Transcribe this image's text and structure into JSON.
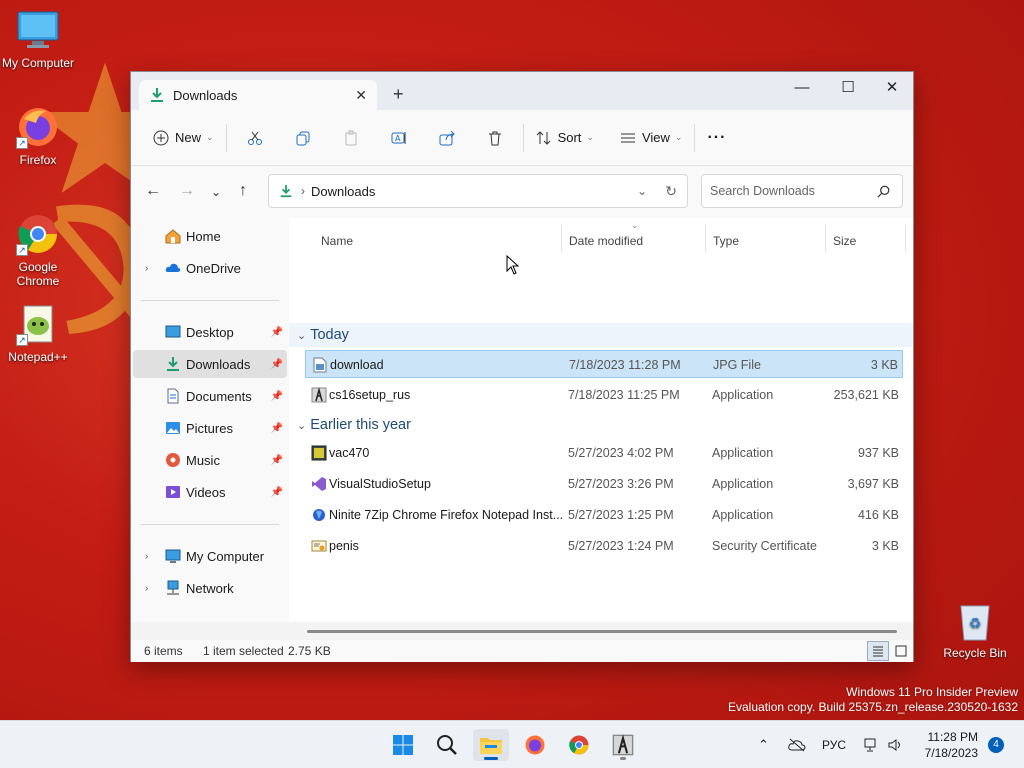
{
  "desktop": {
    "icons": [
      {
        "label": "My Computer",
        "icon": "monitor-icon"
      },
      {
        "label": "Firefox",
        "icon": "firefox-icon"
      },
      {
        "label": "Google Chrome",
        "icon": "chrome-icon"
      },
      {
        "label": "Notepad++",
        "icon": "notepadpp-icon"
      },
      {
        "label": "Recycle Bin",
        "icon": "recycle-bin-icon"
      }
    ],
    "watermark_line1": "Windows 11 Pro Insider Preview",
    "watermark_line2": "Evaluation copy. Build 25375.zn_release.230520-1632"
  },
  "window": {
    "tab_title": "Downloads",
    "toolbar": {
      "new_label": "New",
      "sort_label": "Sort",
      "view_label": "View",
      "more_label": "···"
    },
    "address": {
      "path": "Downloads",
      "search_placeholder": "Search Downloads"
    },
    "sidebar": {
      "items": [
        {
          "label": "Home",
          "icon": "home-icon"
        },
        {
          "label": "OneDrive",
          "icon": "onedrive-icon"
        },
        {
          "label": "Desktop",
          "icon": "desktop-icon"
        },
        {
          "label": "Downloads",
          "icon": "download-icon"
        },
        {
          "label": "Documents",
          "icon": "documents-icon"
        },
        {
          "label": "Pictures",
          "icon": "pictures-icon"
        },
        {
          "label": "Music",
          "icon": "music-icon"
        },
        {
          "label": "Videos",
          "icon": "videos-icon"
        },
        {
          "label": "My Computer",
          "icon": "computer-icon"
        },
        {
          "label": "Network",
          "icon": "network-icon"
        }
      ]
    },
    "columns": {
      "name": "Name",
      "date": "Date modified",
      "type": "Type",
      "size": "Size"
    },
    "groups": [
      {
        "title": "Today",
        "files": [
          {
            "name": "download",
            "date": "7/18/2023 11:28 PM",
            "type": "JPG File",
            "size": "3 KB",
            "icon": "image-file-icon"
          },
          {
            "name": "cs16setup_rus",
            "date": "7/18/2023 11:25 PM",
            "type": "Application",
            "size": "253,621 KB",
            "icon": "cs-app-icon"
          }
        ]
      },
      {
        "title": "Earlier this year",
        "files": [
          {
            "name": "vac470",
            "date": "5/27/2023 4:02 PM",
            "type": "Application",
            "size": "937 KB",
            "icon": "vac-app-icon"
          },
          {
            "name": "VisualStudioSetup",
            "date": "5/27/2023 3:26 PM",
            "type": "Application",
            "size": "3,697 KB",
            "icon": "visual-studio-icon"
          },
          {
            "name": "Ninite 7Zip Chrome Firefox Notepad Inst...",
            "date": "5/27/2023 1:25 PM",
            "type": "Application",
            "size": "416 KB",
            "icon": "ninite-icon"
          },
          {
            "name": "penis",
            "date": "5/27/2023 1:24 PM",
            "type": "Security Certificate",
            "size": "3 KB",
            "icon": "certificate-icon"
          }
        ]
      }
    ],
    "status": {
      "items": "6 items",
      "selection": "1 item selected",
      "selection_size": "2.75 KB"
    }
  },
  "taskbar": {
    "tray_lang": "РУС",
    "time": "11:28 PM",
    "date": "7/18/2023",
    "notification_count": "4"
  },
  "colors": {
    "accent": "#005fb8",
    "selection": "#cce4f7",
    "wallpaper": "#c41d14"
  }
}
